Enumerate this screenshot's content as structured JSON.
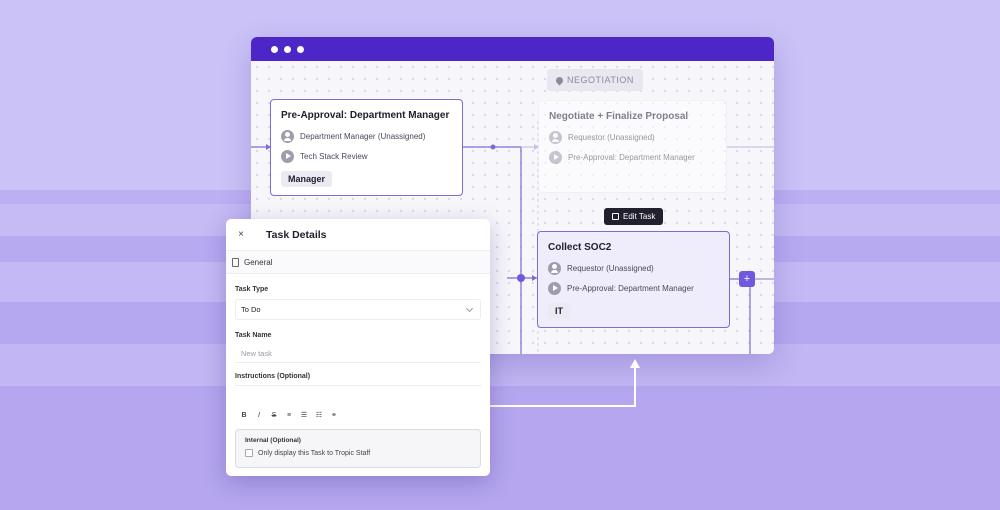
{
  "colors": {
    "titlebar": "#4c26c6",
    "accent": "#6f59df",
    "card_border": "#7c6cd3",
    "background": "#c9bff5"
  },
  "workflow": {
    "stage_tag": "NEGOTIATION",
    "cards": {
      "pre_approval": {
        "title": "Pre-Approval: Department Manager",
        "assignee": "Department Manager (Unassigned)",
        "trigger": "Tech Stack Review",
        "tag": "Manager"
      },
      "negotiate": {
        "title": "Negotiate + Finalize Proposal",
        "assignee": "Requestor (Unassigned)",
        "trigger": "Pre-Approval: Department Manager"
      },
      "soc2": {
        "title": "Collect SOC2",
        "assignee": "Requestor (Unassigned)",
        "trigger": "Pre-Approval: Department Manager",
        "tag": "IT"
      }
    },
    "edit_task_label": "Edit Task",
    "add_label": "+"
  },
  "panel": {
    "close_label": "×",
    "title": "Task Details",
    "tab_general": "General",
    "task_type_label": "Task Type",
    "task_type_value": "To Do",
    "task_name_label": "Task Name",
    "task_name_placeholder": "New task",
    "instructions_label": "Instructions (Optional)",
    "toolbar": {
      "bold": "B",
      "italic": "I",
      "strike": "S",
      "align": "≡",
      "bullets": "☰",
      "numbered": "☷",
      "link": "⚭"
    },
    "internal_title": "Internal (Optional)",
    "internal_checkbox_label": "Only display this Task to Tropic Staff"
  }
}
